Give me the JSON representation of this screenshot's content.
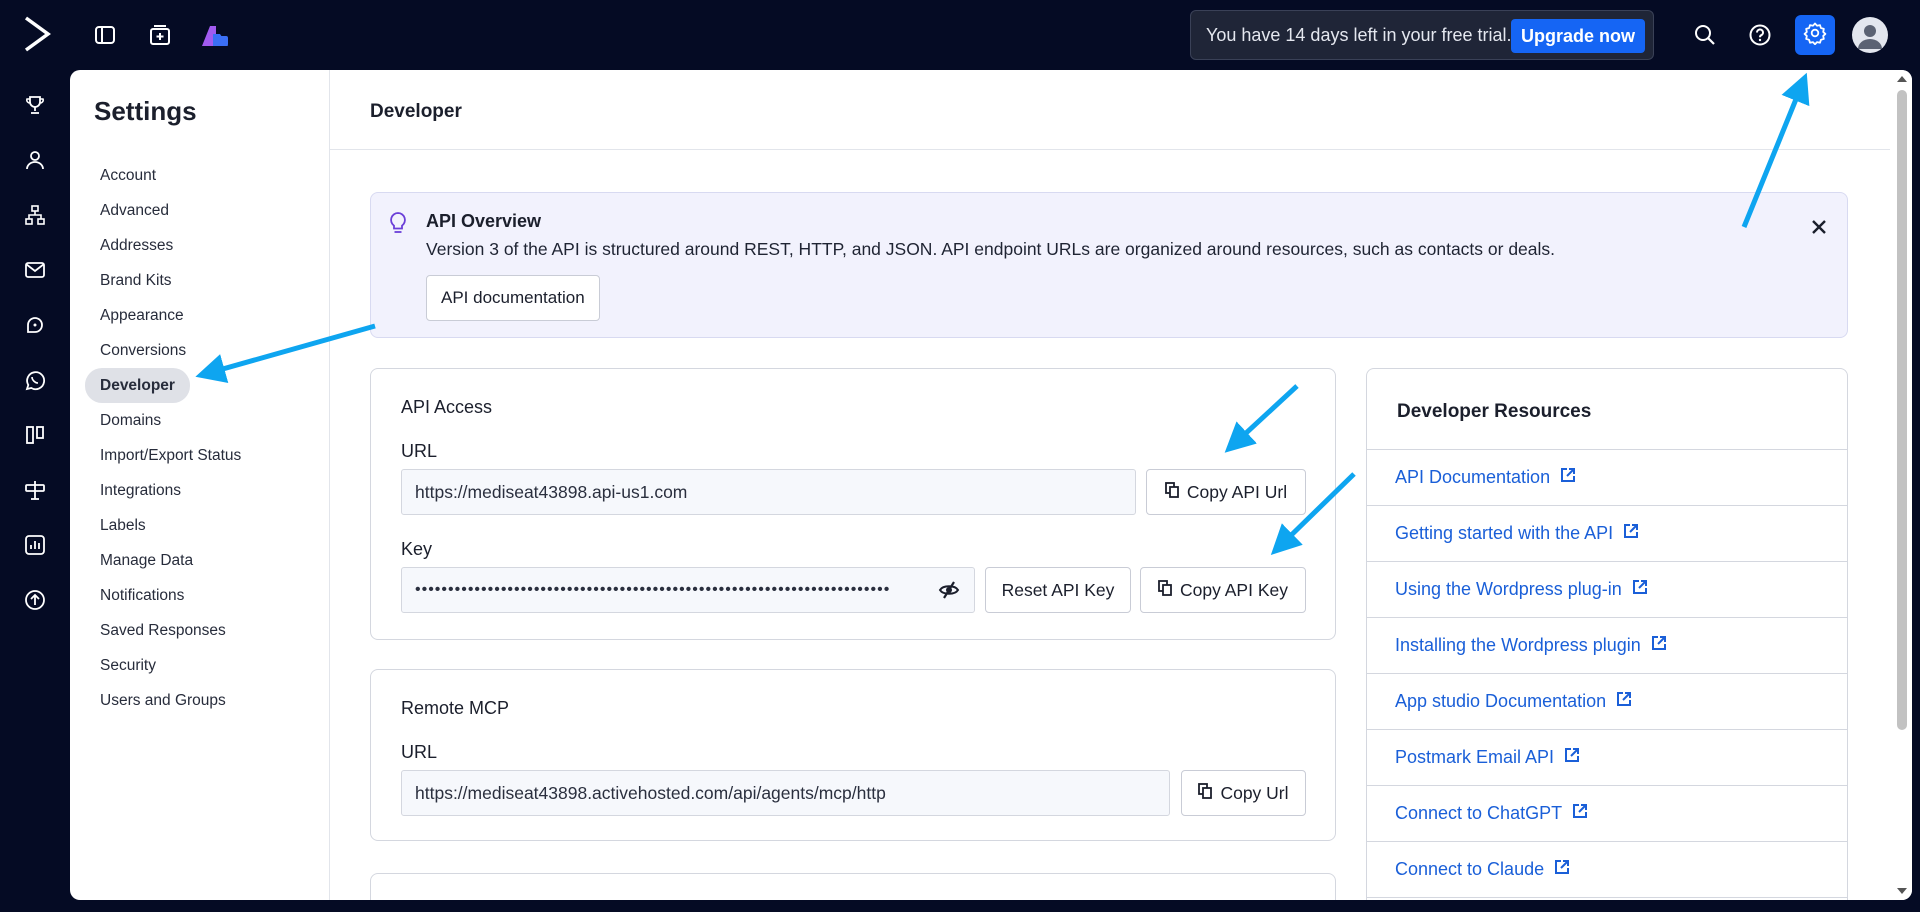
{
  "topbar": {
    "trial_text": "You have 14 days left in your free trial.",
    "upgrade_label": "Upgrade now"
  },
  "settings": {
    "title": "Settings",
    "nav_items": [
      {
        "label": "Account"
      },
      {
        "label": "Advanced"
      },
      {
        "label": "Addresses"
      },
      {
        "label": "Brand Kits"
      },
      {
        "label": "Appearance"
      },
      {
        "label": "Conversions"
      },
      {
        "label": "Developer"
      },
      {
        "label": "Domains"
      },
      {
        "label": "Import/Export Status"
      },
      {
        "label": "Integrations"
      },
      {
        "label": "Labels"
      },
      {
        "label": "Manage Data"
      },
      {
        "label": "Notifications"
      },
      {
        "label": "Saved Responses"
      },
      {
        "label": "Security"
      },
      {
        "label": "Users and Groups"
      }
    ],
    "active_item": "Developer"
  },
  "content": {
    "title": "Developer",
    "overview": {
      "title": "API Overview",
      "description": "Version 3 of the API is structured around REST, HTTP, and JSON. API endpoint URLs are organized around resources, such as contacts or deals.",
      "doc_button": "API documentation"
    },
    "api_access": {
      "title": "API Access",
      "url_label": "URL",
      "url_value": "https://mediseat43898.api-us1.com",
      "copy_url_label": "Copy API Url",
      "key_label": "Key",
      "key_value": "••••••••••••••••••••••••••••••••••••••••••••••••••••••••••••••••••••••••",
      "reset_key_label": "Reset API Key",
      "copy_key_label": "Copy API Key"
    },
    "remote_mcp": {
      "title": "Remote MCP",
      "url_label": "URL",
      "url_value": "https://mediseat43898.activehosted.com/api/agents/mcp/http",
      "copy_url_label": "Copy Url"
    },
    "resources": {
      "title": "Developer Resources",
      "links": [
        {
          "label": "API Documentation"
        },
        {
          "label": "Getting started with the API"
        },
        {
          "label": "Using the Wordpress plug-in"
        },
        {
          "label": "Installing the Wordpress plugin"
        },
        {
          "label": "App studio Documentation"
        },
        {
          "label": "Postmark Email API"
        },
        {
          "label": "Connect to ChatGPT"
        },
        {
          "label": "Connect to Claude"
        }
      ]
    }
  },
  "colors": {
    "background": "#050b24",
    "accent": "#1565f4",
    "link": "#1a5fd8",
    "annotation_arrow": "#0ea5f0"
  }
}
